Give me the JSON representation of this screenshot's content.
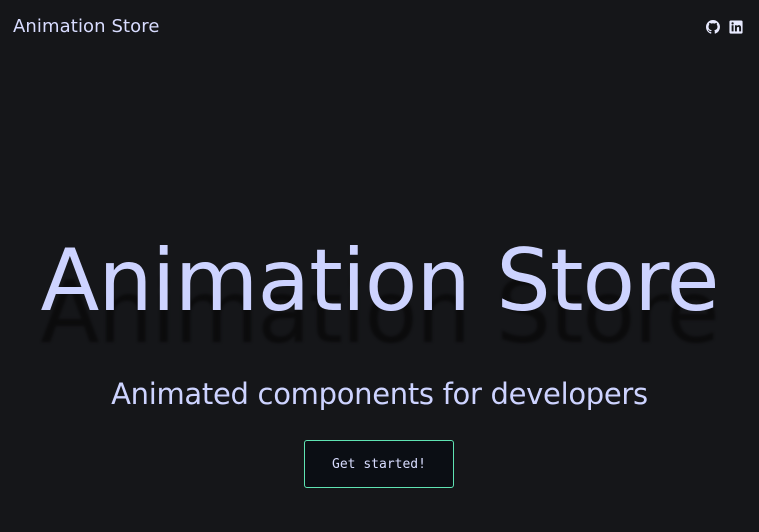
{
  "header": {
    "brand": "Animation Store",
    "social": [
      {
        "icon": "github-icon"
      },
      {
        "icon": "linkedin-icon"
      }
    ]
  },
  "hero": {
    "title": "Animation Store",
    "subtitle": "Animated components for developers",
    "cta_label": "Get started!"
  },
  "colors": {
    "background": "#151619",
    "text": "#cdd3ff",
    "accent_border": "#5fe3b3"
  }
}
